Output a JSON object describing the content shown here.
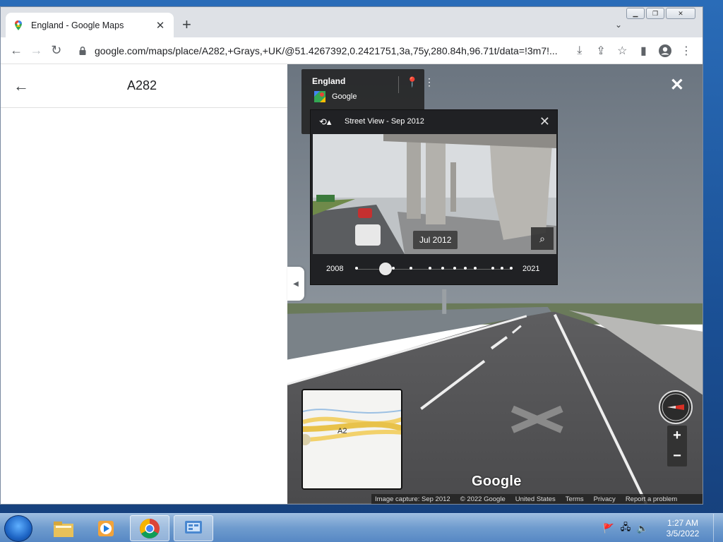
{
  "browser": {
    "tab_title": "England - Google Maps",
    "url": "google.com/maps/place/A282,+Grays,+UK/@51.4267392,0.2421751,3a,75y,280.84h,96.71t/data=!3m7!..."
  },
  "left_panel": {
    "title": "A282"
  },
  "info_card": {
    "place": "England",
    "provider": "Google"
  },
  "time_machine": {
    "header": "Street View - Sep 2012",
    "current_date": "Jul 2012",
    "start_year": "2008",
    "end_year": "2021",
    "dates_count": 11,
    "selected_index": 1
  },
  "minimap": {
    "road_label": "A2"
  },
  "watermark": "Google",
  "footer": {
    "capture": "Image capture: Sep 2012",
    "copyright": "© 2022 Google",
    "region": "United States",
    "terms": "Terms",
    "privacy": "Privacy",
    "report": "Report a problem"
  },
  "taskbar": {
    "time": "1:27 AM",
    "date": "3/5/2022"
  },
  "icons": {
    "tab_favicon": "google-maps-pin-icon",
    "lock": "lock-icon",
    "history": "history-icon",
    "zoom": "magnifier-icon"
  },
  "colors": {
    "accent": "#1a73e8",
    "panel_dark": "#202124"
  }
}
